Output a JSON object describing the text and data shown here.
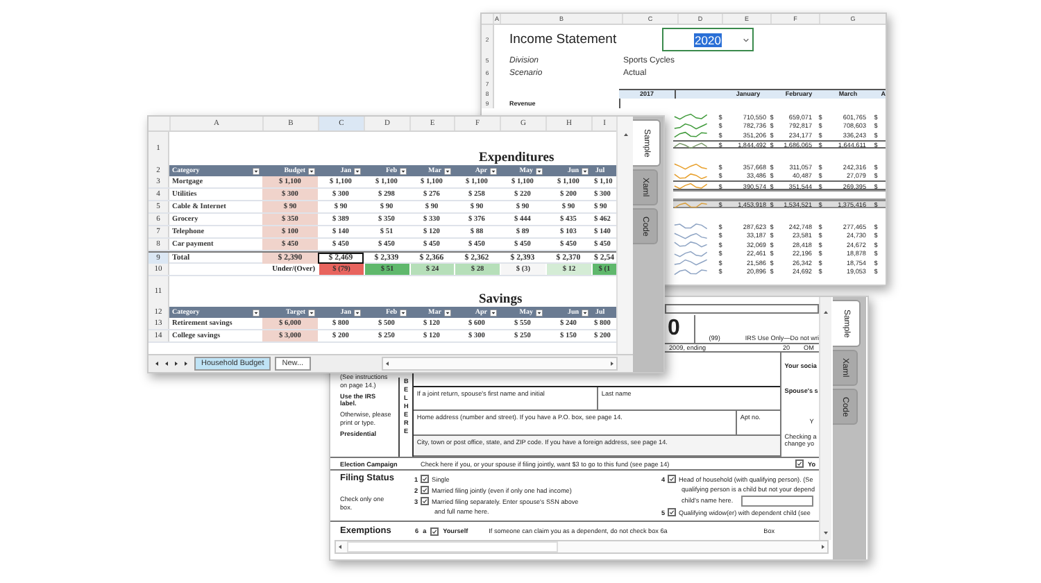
{
  "income_window": {
    "columns": [
      "A",
      "B",
      "C",
      "D",
      "E",
      "F",
      "G"
    ],
    "row_numbers": [
      "2",
      "5",
      "6",
      "7",
      "8",
      "9"
    ],
    "title": "Income Statement",
    "year": "2020",
    "fields": [
      {
        "label": "Division",
        "value": "Sports Cycles"
      },
      {
        "label": "Scenario",
        "value": "Actual"
      }
    ],
    "header": [
      "2017",
      "January",
      "February",
      "March",
      "A"
    ],
    "section": "Revenue",
    "currency": "$",
    "rows": [
      {
        "kind": "data",
        "color": "#3f9a3a",
        "values": [
          "710,550",
          "659,071",
          "601,765"
        ]
      },
      {
        "kind": "data",
        "color": "#3f9a3a",
        "values": [
          "782,736",
          "792,817",
          "708,603"
        ]
      },
      {
        "kind": "data",
        "color": "#3f9a3a",
        "values": [
          "351,206",
          "234,177",
          "336,243"
        ]
      },
      {
        "kind": "total",
        "color": "#7a9a6a",
        "values": [
          "1,844,492",
          "1,686,065",
          "1,644,611"
        ]
      },
      {
        "kind": "spacer"
      },
      {
        "kind": "data",
        "color": "#e8a02c",
        "values": [
          "357,668",
          "311,057",
          "242,316"
        ]
      },
      {
        "kind": "data",
        "color": "#e8a02c",
        "values": [
          "33,486",
          "40,487",
          "27,079"
        ]
      },
      {
        "kind": "total",
        "color": "#e8a02c",
        "values": [
          "390,574",
          "351,544",
          "269,395"
        ]
      },
      {
        "kind": "band"
      },
      {
        "kind": "grand",
        "color": "#d9a040",
        "values": [
          "1,453,918",
          "1,534,521",
          "1,375,416"
        ]
      },
      {
        "kind": "spacer"
      },
      {
        "kind": "data",
        "color": "#8ea4c4",
        "values": [
          "287,623",
          "242,748",
          "277,465"
        ]
      },
      {
        "kind": "data",
        "color": "#8ea4c4",
        "values": [
          "33,187",
          "23,581",
          "24,730"
        ]
      },
      {
        "kind": "data",
        "color": "#8ea4c4",
        "values": [
          "32,069",
          "28,418",
          "24,672"
        ]
      },
      {
        "kind": "data",
        "color": "#8ea4c4",
        "values": [
          "22,461",
          "22,196",
          "18,878"
        ]
      },
      {
        "kind": "data",
        "color": "#8ea4c4",
        "values": [
          "21,586",
          "26,342",
          "18,754"
        ]
      },
      {
        "kind": "data",
        "color": "#8ea4c4",
        "values": [
          "20,896",
          "24,692",
          "19,053"
        ]
      }
    ]
  },
  "expenses_window": {
    "columns": [
      {
        "letter": "A",
        "selected": false
      },
      {
        "letter": "B",
        "selected": false
      },
      {
        "letter": "C",
        "selected": true
      },
      {
        "letter": "D",
        "selected": false
      },
      {
        "letter": "E",
        "selected": false
      },
      {
        "letter": "F",
        "selected": false
      },
      {
        "letter": "G",
        "selected": false
      },
      {
        "letter": "H",
        "selected": false
      },
      {
        "letter": "I",
        "selected": false
      }
    ],
    "rows": [
      {
        "num": "1",
        "kind": "title",
        "text": "Expenditures",
        "selected": false
      },
      {
        "num": "2",
        "kind": "header",
        "selected": false,
        "cells": [
          "Category",
          "Budget",
          "Jan",
          "Feb",
          "Mar",
          "Apr",
          "May",
          "Jun",
          "Jul"
        ]
      },
      {
        "num": "3",
        "kind": "data",
        "selected": false,
        "cells": [
          "Mortgage",
          "$ 1,100",
          "$ 1,100",
          "$ 1,100",
          "$ 1,100",
          "$ 1,100",
          "$ 1,100",
          "$ 1,100",
          "$ 1,10"
        ]
      },
      {
        "num": "4",
        "kind": "data",
        "selected": false,
        "cells": [
          "Utilities",
          "$ 300",
          "$ 300",
          "$ 298",
          "$ 276",
          "$ 258",
          "$ 220",
          "$ 200",
          "$ 300"
        ]
      },
      {
        "num": "5",
        "kind": "data",
        "selected": false,
        "cells": [
          "Cable & Internet",
          "$ 90",
          "$ 90",
          "$ 90",
          "$ 90",
          "$ 90",
          "$ 90",
          "$ 90",
          "$ 90"
        ]
      },
      {
        "num": "6",
        "kind": "data",
        "selected": false,
        "cells": [
          "Grocery",
          "$ 350",
          "$ 389",
          "$ 350",
          "$ 330",
          "$ 376",
          "$ 444",
          "$ 435",
          "$ 462"
        ]
      },
      {
        "num": "7",
        "kind": "data",
        "selected": false,
        "cells": [
          "Telephone",
          "$ 100",
          "$ 140",
          "$ 51",
          "$ 120",
          "$ 88",
          "$ 89",
          "$ 103",
          "$ 140"
        ]
      },
      {
        "num": "8",
        "kind": "data",
        "selected": false,
        "cells": [
          "Car payment",
          "$ 450",
          "$ 450",
          "$ 450",
          "$ 450",
          "$ 450",
          "$ 450",
          "$ 450",
          "$ 450"
        ]
      },
      {
        "num": "9",
        "kind": "total",
        "selected": true,
        "cells": [
          "Total",
          "$ 2,390",
          "$ 2,469",
          "$ 2,339",
          "$ 2,366",
          "$ 2,362",
          "$ 2,393",
          "$ 2,370",
          "$ 2,54"
        ]
      },
      {
        "num": "10",
        "kind": "variance",
        "selected": false,
        "label": "Under/(Over)",
        "cells": [
          {
            "text": "$ (79)",
            "color": "#e8645e"
          },
          {
            "text": "$ 51",
            "color": "#5fb86c"
          },
          {
            "text": "$ 24",
            "color": "#b6dfb9"
          },
          {
            "text": "$ 28",
            "color": "#b6dfb9"
          },
          {
            "text": "$ (3)",
            "color": "#f6f6f6"
          },
          {
            "text": "$ 12",
            "color": "#d4ecd5"
          },
          {
            "text": "$ (1",
            "color": "#5fb86c"
          }
        ]
      },
      {
        "num": "11",
        "kind": "title",
        "text": "Savings",
        "selected": false
      },
      {
        "num": "12",
        "kind": "header",
        "selected": false,
        "cells": [
          "Category",
          "Target",
          "Jan",
          "Feb",
          "Mar",
          "Apr",
          "May",
          "Jun",
          "Jul"
        ]
      },
      {
        "num": "13",
        "kind": "data",
        "selected": false,
        "cells": [
          "Retirement savings",
          "$ 6,000",
          "$ 800",
          "$ 500",
          "$ 120",
          "$ 600",
          "$ 550",
          "$ 240",
          "$ 800"
        ]
      },
      {
        "num": "14",
        "kind": "data",
        "selected": false,
        "cells": [
          "College savings",
          "$ 3,000",
          "$ 200",
          "$ 250",
          "$ 120",
          "$ 300",
          "$ 250",
          "$ 150",
          "$ 200"
        ]
      }
    ],
    "sheet_tabs": [
      {
        "label": "Household Budget",
        "selected": true
      },
      {
        "label": "New...",
        "selected": false
      }
    ],
    "side_tabs": [
      {
        "label": "Sample",
        "selected": true
      },
      {
        "label": "Xaml",
        "selected": false
      },
      {
        "label": "Code",
        "selected": false
      }
    ]
  },
  "form_window": {
    "year_tail": "0",
    "form_code": "(99)",
    "irs_note": "IRS Use Only—Do not wri",
    "period": "2009, ending",
    "period_year": "20",
    "omb": "OM",
    "label_notes": [
      {
        "text": "(See instructions on page 14.)",
        "bold": false
      },
      {
        "text": "Use the IRS label.",
        "bold": true
      },
      {
        "text": "Otherwise, please print or type.",
        "bold": false
      },
      {
        "text": "Presidential",
        "bold": true
      }
    ],
    "label_letters": "BEL HERE",
    "name_fields": [
      "If a joint return, spouse's first name and initial",
      "Last name"
    ],
    "address_fields": [
      "Home address (number and street). If you have a P.O. box, see page 14.",
      "Apt no."
    ],
    "city_field": "City, town or post office, state, and ZIP code. If you have a foreign address, see page 14.",
    "side_notes": [
      "Your socia",
      "Spouse's s",
      "Y",
      "Checking a",
      "change yo"
    ],
    "election": {
      "title": "Election Campaign",
      "text": "Check here if you, or your spouse if filing jointly, want $3 to go to this fund (see page 14)",
      "checked": true,
      "answer": "Yo"
    },
    "filing_status": {
      "title": "Filing Status",
      "hint": "Check only one box.",
      "options": [
        {
          "num": "1",
          "lines": [
            "Single"
          ],
          "checked": true
        },
        {
          "num": "2",
          "lines": [
            "Married filing jointly (even if only one had income)"
          ],
          "checked": true
        },
        {
          "num": "3",
          "lines": [
            "Married filing separately. Enter spouse's SSN above",
            "and full name here."
          ],
          "checked": true
        },
        {
          "num": "4",
          "lines": [
            "Head of household (with qualifying person). (Se",
            "qualifying person is a child but not your depend",
            "child's name here."
          ],
          "checked": true
        },
        {
          "num": "5",
          "lines": [
            "Qualifying widow(er) with dependent child (see"
          ],
          "checked": true
        }
      ]
    },
    "exemptions": {
      "title": "Exemptions",
      "num": "6",
      "letter": "a",
      "label": "Yourself",
      "checked": true,
      "note": "If someone can claim you as a dependent, do not check box 6a",
      "side": "Box"
    },
    "side_tabs": [
      {
        "label": "Sample",
        "selected": true
      },
      {
        "label": "Xaml",
        "selected": false
      },
      {
        "label": "Code",
        "selected": false
      }
    ]
  }
}
